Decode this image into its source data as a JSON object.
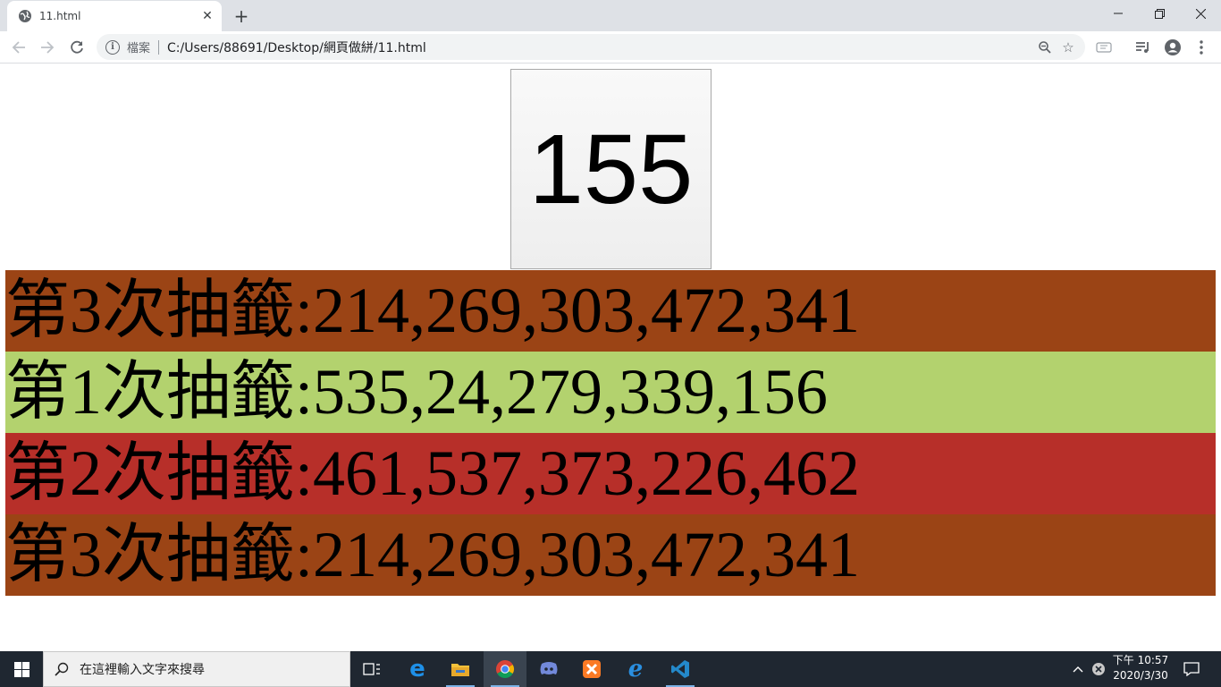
{
  "browser": {
    "tab": {
      "title": "11.html",
      "favicon": "globe-icon",
      "close_icon": "close-icon"
    },
    "new_tab_icon": "plus-icon",
    "window_controls": [
      "minimize-icon",
      "restore-icon",
      "close-icon"
    ],
    "nav": {
      "back_icon": "back-arrow-icon",
      "forward_icon": "forward-arrow-icon",
      "reload_icon": "reload-icon"
    },
    "address": {
      "info_icon": "info-icon",
      "scheme_label": "檔案",
      "url": "C:/Users/88691/Desktop/網頁做絣/11.html",
      "zoom_icon": "zoom-icon",
      "bookmark_icon": "star-icon"
    },
    "extensions": [
      "extension-ticket-icon",
      "media-control-icon",
      "profile-icon",
      "menu-kebab-icon"
    ]
  },
  "page": {
    "counter": {
      "value": "155"
    },
    "rows": [
      {
        "text": "第3次抽籤:214,269,303,472,341",
        "bg": "#9b4415"
      },
      {
        "text": "第1次抽籤:535,24,279,339,156",
        "bg": "#b3d26e"
      },
      {
        "text": "第2次抽籤:461,537,373,226,462",
        "bg": "#b72f29"
      },
      {
        "text": "第3次抽籤:214,269,303,472,341",
        "bg": "#9b4415"
      }
    ]
  },
  "taskbar": {
    "search_placeholder": "在這裡輸入文字來搜尋",
    "apps": [
      "task-view-icon",
      "edge-icon",
      "file-explorer-icon",
      "chrome-icon",
      "discord-icon",
      "xampp-icon",
      "ie-icon",
      "vscode-icon"
    ],
    "clock": {
      "period_time": "下午 10:57",
      "date": "2020/3/30"
    }
  },
  "colors": {
    "tabstrip": "#dee1e6",
    "taskbar": "#1f2731",
    "row_brown": "#9b4415",
    "row_green": "#b3d26e",
    "row_red": "#b72f29"
  }
}
